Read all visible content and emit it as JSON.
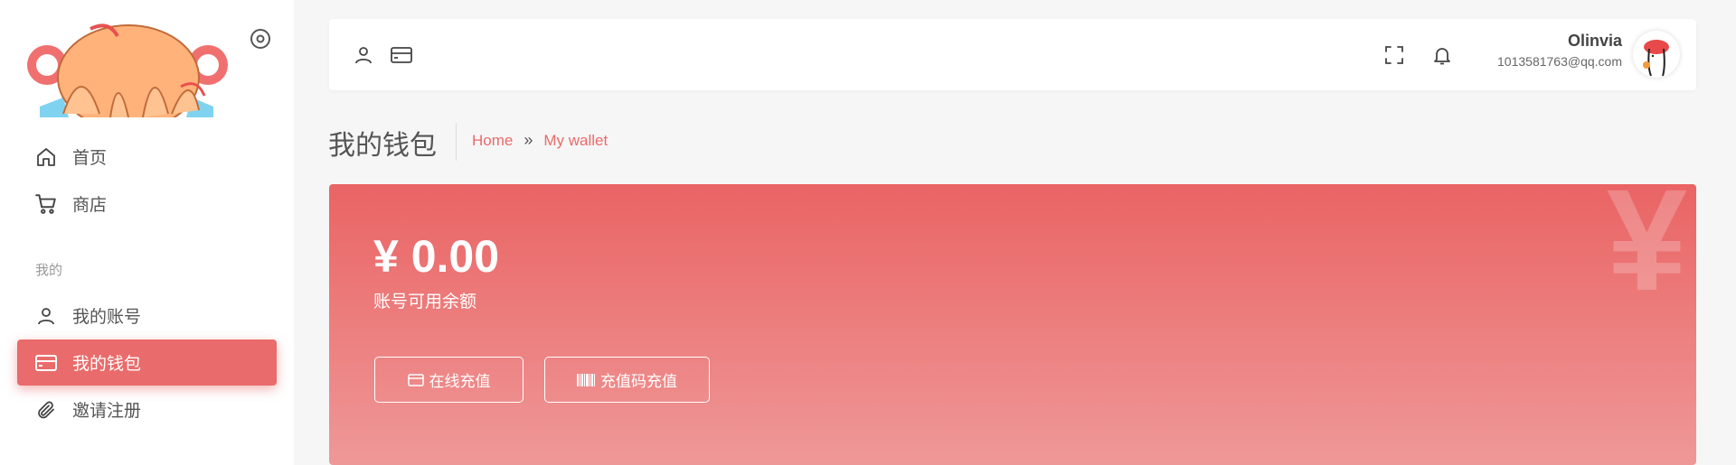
{
  "sidebar": {
    "section_label": "我的",
    "items": [
      {
        "label": "首页",
        "icon": "home-icon"
      },
      {
        "label": "商店",
        "icon": "cart-icon"
      },
      {
        "label": "我的账号",
        "icon": "user-icon"
      },
      {
        "label": "我的钱包",
        "icon": "wallet-icon",
        "active": true
      },
      {
        "label": "邀请注册",
        "icon": "paperclip-icon"
      }
    ]
  },
  "header": {
    "left_icons": [
      "user-icon",
      "card-icon"
    ],
    "right_icons": [
      "fullscreen-icon",
      "bell-icon"
    ],
    "user": {
      "name": "Olinvia",
      "email": "1013581763@qq.com"
    }
  },
  "page": {
    "title": "我的钱包",
    "breadcrumb": [
      {
        "label": "Home"
      },
      {
        "label": "My wallet"
      }
    ],
    "breadcrumb_sep": "»"
  },
  "wallet": {
    "balance": "¥ 0.00",
    "balance_label": "账号可用余额",
    "watermark": "¥",
    "buttons": [
      {
        "label": "在线充值",
        "icon": "card-icon"
      },
      {
        "label": "充值码充值",
        "icon": "barcode-icon"
      }
    ]
  },
  "colors": {
    "accent": "#ea6b6b",
    "card_top": "#ea6464",
    "card_bottom": "#ef9898",
    "background": "#f6f6f6"
  }
}
